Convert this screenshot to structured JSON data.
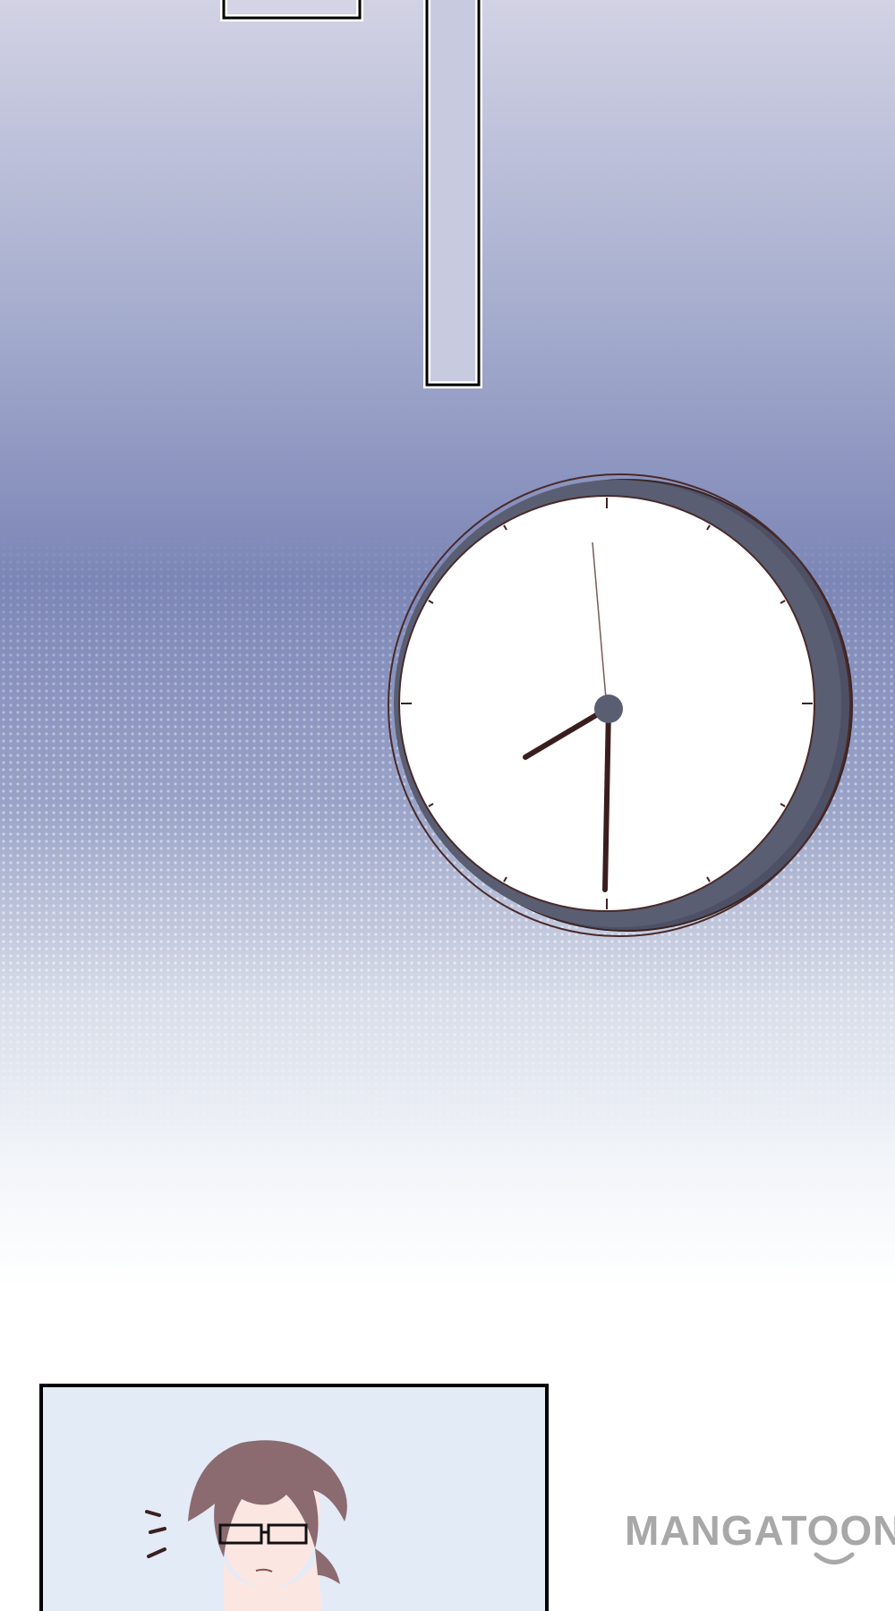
{
  "page": {
    "background_top": "#cfcfe2",
    "background_mid": "#7e88b8",
    "background_bottom": "#ffffff"
  },
  "clock": {
    "face_color": "#ffffff",
    "rim_color": "#5a5e72",
    "outline_color": "#4a2a2a",
    "hand_color": "#3a1e1e",
    "time_shown": "7:30"
  },
  "panel": {
    "background": "#e3ebf6",
    "border_color": "#000000",
    "hair_color": "#8b6a70",
    "skin_color": "#fbe6e2"
  },
  "watermark": {
    "text": "MANGATOON",
    "color": "#a8a8a8",
    "icon": "smile-icon"
  }
}
